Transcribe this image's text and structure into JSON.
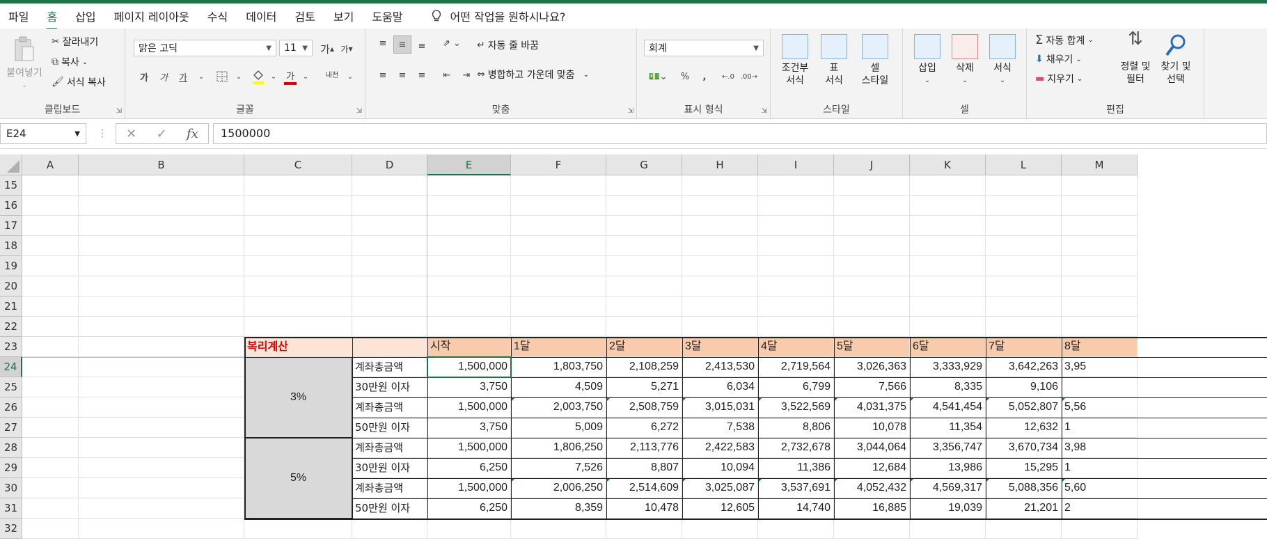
{
  "menu": {
    "tabs": [
      "파일",
      "홈",
      "삽입",
      "페이지 레이아웃",
      "수식",
      "데이터",
      "검토",
      "보기",
      "도움말"
    ],
    "active_tab": "홈",
    "tell_me": "어떤 작업을 원하시나요?"
  },
  "ribbon": {
    "clipboard": {
      "paste": "붙여넣기",
      "cut": "잘라내기",
      "copy": "복사",
      "format_painter": "서식 복사",
      "label": "클립보드"
    },
    "font": {
      "name": "맑은 고딕",
      "size": "11",
      "bold": "가",
      "italic": "가",
      "underline": "가",
      "color_glyph": "가",
      "grow": "가",
      "shrink": "가",
      "phonetic": "내천",
      "label": "글꼴"
    },
    "alignment": {
      "wrap_text": "자동 줄 바꿈",
      "merge_center": "병합하고 가운데 맞춤",
      "label": "맞춤"
    },
    "number": {
      "format": "회계",
      "percent": "%",
      "comma": ",",
      "label": "표시 형식"
    },
    "styles": {
      "conditional": [
        "조건부",
        "서식"
      ],
      "table": [
        "표",
        "서식"
      ],
      "cell_styles": [
        "셀",
        "스타일"
      ],
      "label": "스타일"
    },
    "cells": {
      "insert": "삽입",
      "delete": "삭제",
      "format": "서식",
      "label": "셀"
    },
    "editing": {
      "autosum": "자동 합계",
      "fill": "채우기",
      "clear": "지우기",
      "sort_filter": [
        "정렬 및",
        "필터"
      ],
      "find_select": [
        "찾기 및",
        "선택"
      ],
      "label": "편집"
    }
  },
  "formula_bar": {
    "name_box": "E24",
    "fx": "fx",
    "value": "1500000"
  },
  "columns": [
    "A",
    "B",
    "C",
    "D",
    "E",
    "F",
    "G",
    "H",
    "I",
    "J",
    "K",
    "L",
    "M"
  ],
  "rows": [
    "15",
    "16",
    "17",
    "18",
    "19",
    "20",
    "21",
    "22",
    "23",
    "24",
    "25",
    "26",
    "27",
    "28",
    "29",
    "30",
    "31",
    "32"
  ],
  "table": {
    "title": "복리계산",
    "headers": [
      "시작",
      "1달",
      "2달",
      "3달",
      "4달",
      "5달",
      "6달",
      "7달",
      "8달"
    ],
    "groups": [
      {
        "rate": "3%"
      },
      {
        "rate": "5%"
      }
    ],
    "rows": [
      {
        "label": "계좌총금액",
        "values": [
          "1,500,000",
          "1,803,750",
          "2,108,259",
          "2,413,530",
          "2,719,564",
          "3,026,363",
          "3,333,929",
          "3,642,263",
          "3,95"
        ]
      },
      {
        "label": "30만원 이자",
        "values": [
          "3,750",
          "4,509",
          "5,271",
          "6,034",
          "6,799",
          "7,566",
          "8,335",
          "9,106",
          ""
        ]
      },
      {
        "label": "계좌총금액",
        "values": [
          "1,500,000",
          "2,003,750",
          "2,508,759",
          "3,015,031",
          "3,522,569",
          "4,031,375",
          "4,541,454",
          "5,052,807",
          "5,56"
        ]
      },
      {
        "label": "50만원 이자",
        "values": [
          "3,750",
          "5,009",
          "6,272",
          "7,538",
          "8,806",
          "10,078",
          "11,354",
          "12,632",
          "1"
        ]
      },
      {
        "label": "계좌총금액",
        "values": [
          "1,500,000",
          "1,806,250",
          "2,113,776",
          "2,422,583",
          "2,732,678",
          "3,044,064",
          "3,356,747",
          "3,670,734",
          "3,98"
        ]
      },
      {
        "label": "30만원 이자",
        "values": [
          "6,250",
          "7,526",
          "8,807",
          "10,094",
          "11,386",
          "12,684",
          "13,986",
          "15,295",
          "1"
        ]
      },
      {
        "label": "계좌총금액",
        "values": [
          "1,500,000",
          "2,006,250",
          "2,514,609",
          "3,025,087",
          "3,537,691",
          "4,052,432",
          "4,569,317",
          "5,088,356",
          "5,60"
        ]
      },
      {
        "label": "50만원 이자",
        "values": [
          "6,250",
          "8,359",
          "10,478",
          "12,605",
          "14,740",
          "16,885",
          "19,039",
          "21,201",
          "2"
        ]
      }
    ]
  },
  "colors": {
    "accent": "#217346",
    "header_fill": "#f8cbad",
    "title_text": "#e00000",
    "rate_fill": "#d9d9d9"
  }
}
